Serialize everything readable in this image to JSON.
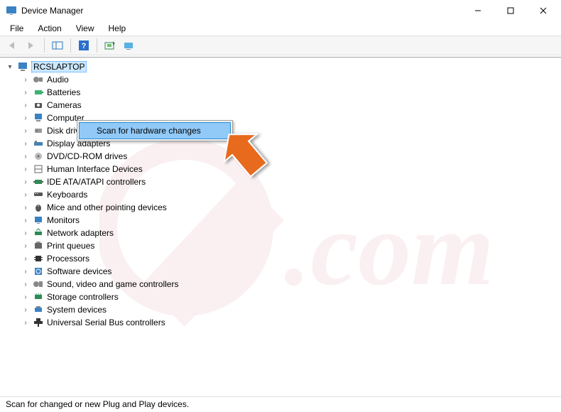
{
  "window": {
    "title": "Device Manager"
  },
  "menubar": {
    "file": "File",
    "action": "Action",
    "view": "View",
    "help": "Help"
  },
  "tree": {
    "root": "RCSLAPTOP",
    "items": [
      "Audio",
      "Batteries",
      "Cameras",
      "Computer",
      "Disk drives",
      "Display adapters",
      "DVD/CD-ROM drives",
      "Human Interface Devices",
      "IDE ATA/ATAPI controllers",
      "Keyboards",
      "Mice and other pointing devices",
      "Monitors",
      "Network adapters",
      "Print queues",
      "Processors",
      "Software devices",
      "Sound, video and game controllers",
      "Storage controllers",
      "System devices",
      "Universal Serial Bus controllers"
    ]
  },
  "context_menu": {
    "item0": "Scan for hardware changes"
  },
  "statusbar": {
    "text": "Scan for changed or new Plug and Play devices."
  },
  "icons": {
    "audio": "#2e8b57",
    "batteries": "#3cb371",
    "cameras": "#4a4a4a",
    "computer": "#1e90ff",
    "disk": "#808080",
    "display": "#4682b4",
    "dvd": "#a0a0a0",
    "hid": "#606060",
    "ide": "#2e8b57",
    "keyboards": "#4a4a4a",
    "mice": "#4a4a4a",
    "monitors": "#1e90ff",
    "network": "#2e8b57",
    "print": "#4a4a4a",
    "processors": "#333",
    "software": "#1e90ff",
    "sound": "#808080",
    "storage": "#2e8b57",
    "system": "#1e90ff",
    "usb": "#333"
  }
}
